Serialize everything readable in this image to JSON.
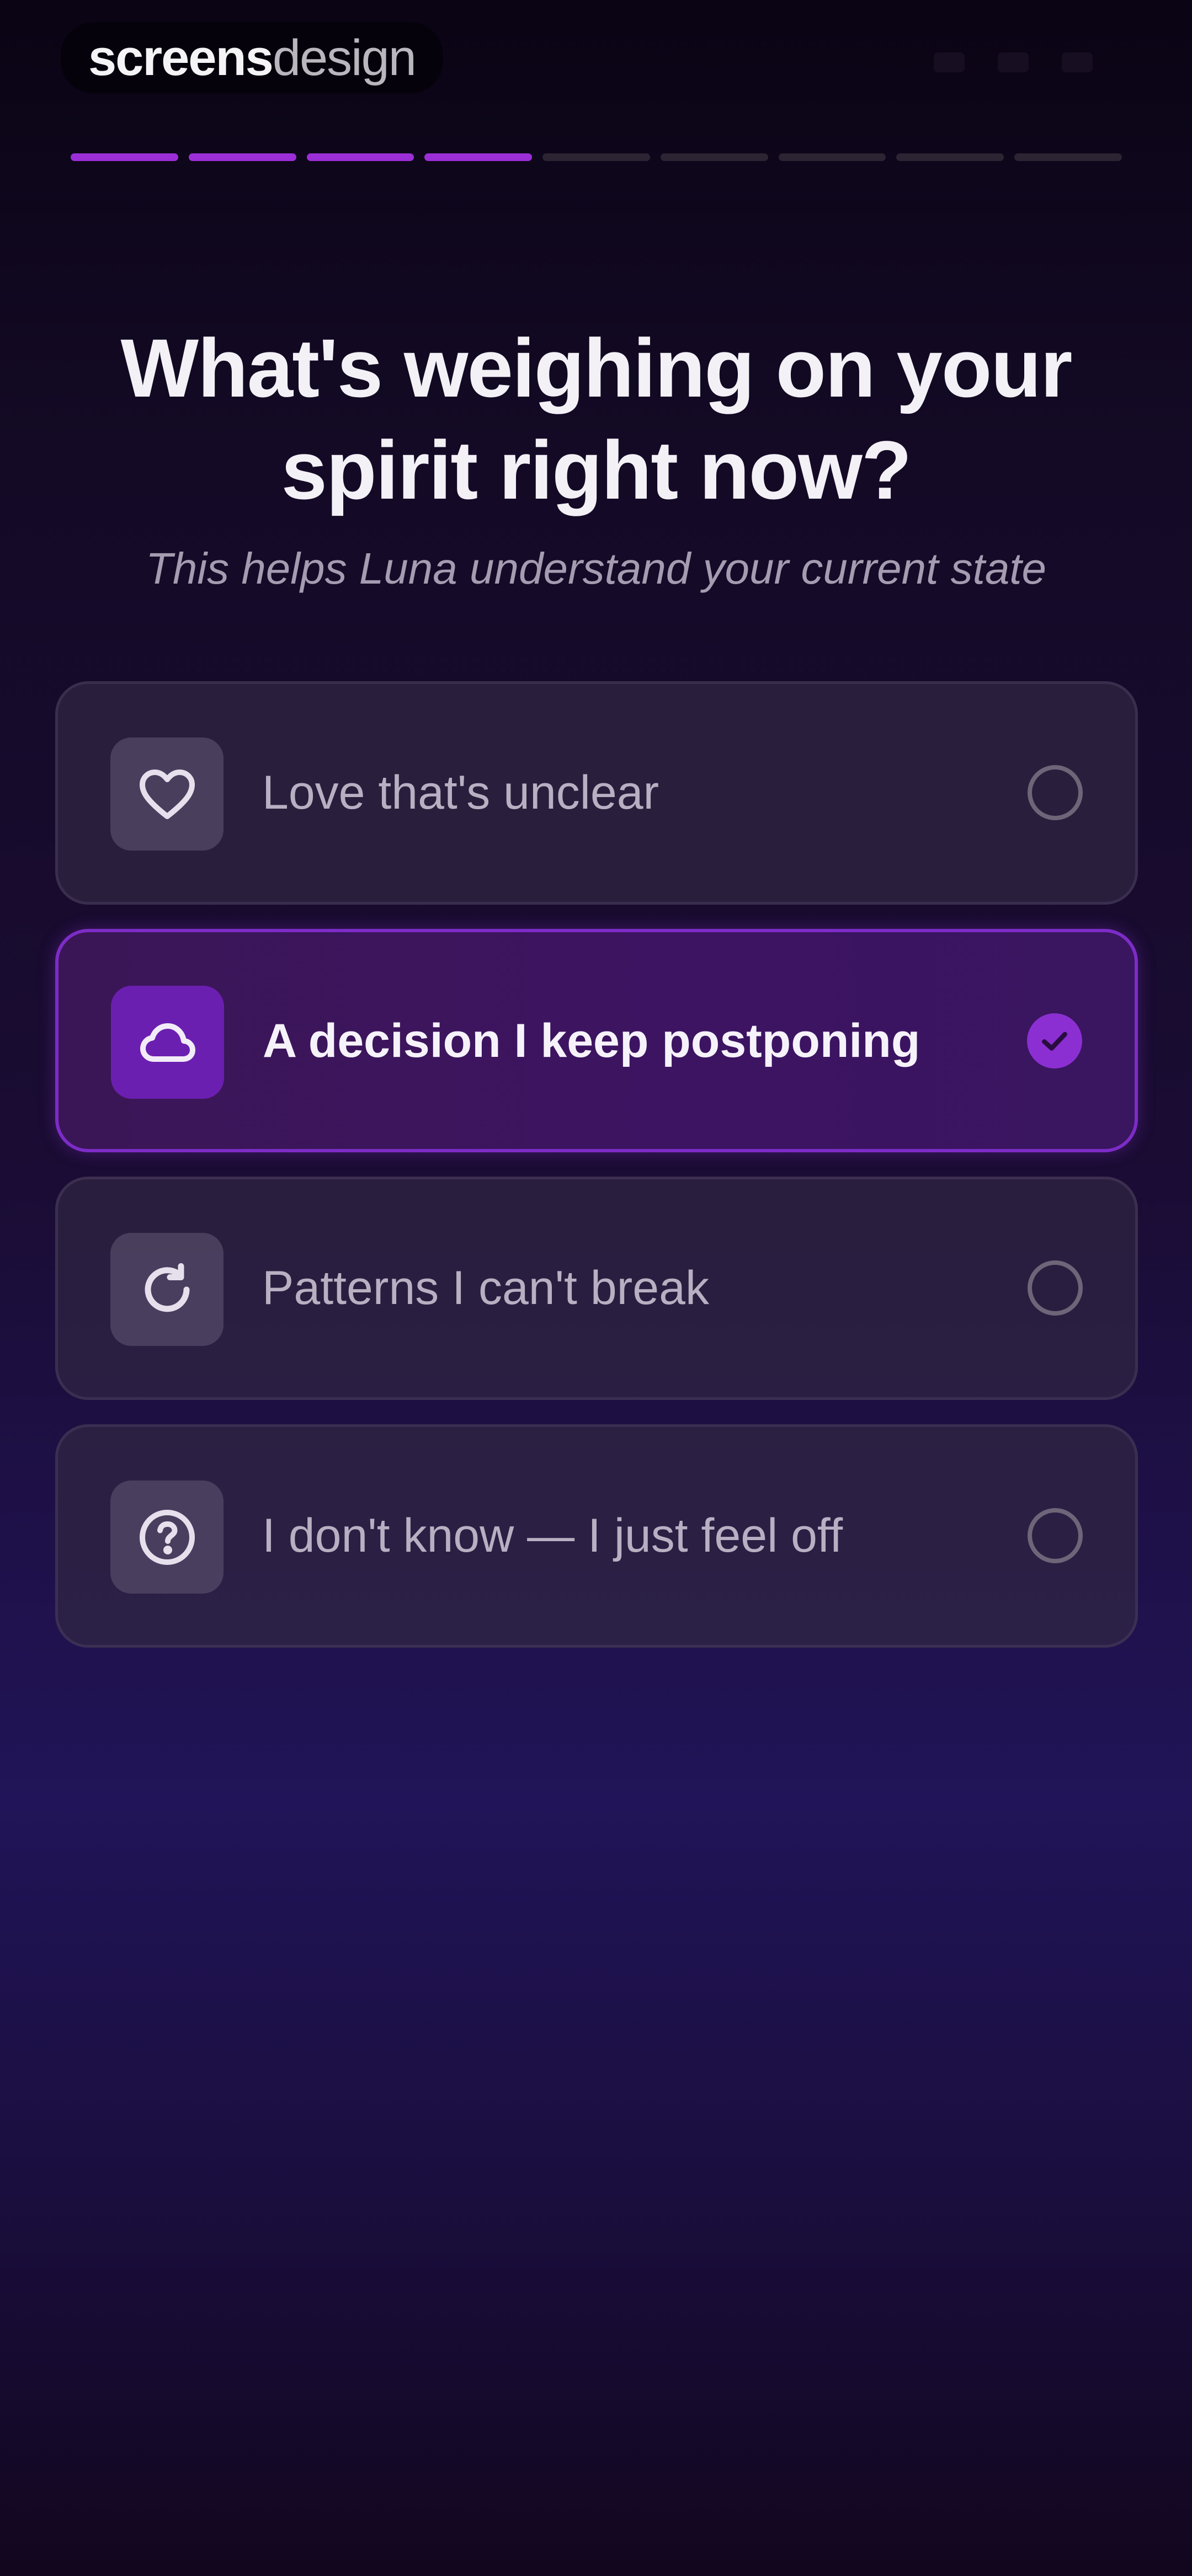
{
  "brand": {
    "strong": "screens",
    "light": "design"
  },
  "progress": {
    "total_steps": 9,
    "completed_steps": 4,
    "accent": "#9b2ed6"
  },
  "title": "What's weighing on your spirit right now?",
  "subtitle": "This helps Luna understand your current state",
  "options": [
    {
      "label": "Love that's unclear",
      "icon": "heart-icon",
      "selected": false
    },
    {
      "label": "A decision I keep postponing",
      "icon": "cloud-icon",
      "selected": true
    },
    {
      "label": "Patterns I can't break",
      "icon": "refresh-icon",
      "selected": false
    },
    {
      "label": "I don't know — I just feel off",
      "icon": "question-circle-icon",
      "selected": false
    }
  ],
  "colors": {
    "selected_border": "#7d2cc7",
    "selected_icon_bg": "#6b1fb0",
    "check": "#8b2fd2"
  }
}
